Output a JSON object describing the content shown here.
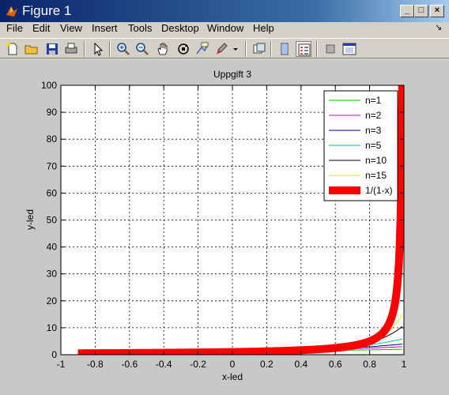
{
  "window": {
    "title": "Figure 1",
    "minimize": "_",
    "maximize": "□",
    "close": "×"
  },
  "menu": {
    "items": [
      "File",
      "Edit",
      "View",
      "Insert",
      "Tools",
      "Desktop",
      "Window",
      "Help"
    ],
    "dock_icon": "↘"
  },
  "toolbar": {
    "icons": [
      "new-figure",
      "open-file",
      "save",
      "print",
      "select-arrow",
      "zoom-in",
      "zoom-out",
      "pan",
      "rotate-3d",
      "data-cursor",
      "brush",
      "brush-dropdown",
      "link-plot",
      "hide-plot-tools",
      "show-plot-tools",
      "toggle-colorbar",
      "toggle-legend"
    ]
  },
  "chart_data": {
    "type": "line",
    "title": "Uppgift 3",
    "xlabel": "x-led",
    "ylabel": "y-led",
    "xlim": [
      -1,
      1
    ],
    "ylim": [
      0,
      100
    ],
    "xticks": [
      "-1",
      "-0.8",
      "-0.6",
      "-0.4",
      "-0.2",
      "0",
      "0.2",
      "0.4",
      "0.6",
      "0.8",
      "1"
    ],
    "yticks": [
      "0",
      "10",
      "20",
      "30",
      "40",
      "50",
      "60",
      "70",
      "80",
      "90",
      "100"
    ],
    "grid": true,
    "legend_position": "top-right",
    "series": [
      {
        "name": "n=1",
        "color": "#00c000",
        "n": 1
      },
      {
        "name": "n=2",
        "color": "#c000c0",
        "n": 2
      },
      {
        "name": "n=3",
        "color": "#000080",
        "n": 3
      },
      {
        "name": "n=5",
        "color": "#00c0c0",
        "n": 5
      },
      {
        "name": "n=10",
        "color": "#000000",
        "n": 10
      },
      {
        "name": "n=15",
        "color": "#e8e800",
        "n": 15
      },
      {
        "name": "1/(1-x)",
        "color": "#ff0000",
        "n": null
      }
    ],
    "x_range": [
      -0.9,
      0.99
    ]
  }
}
